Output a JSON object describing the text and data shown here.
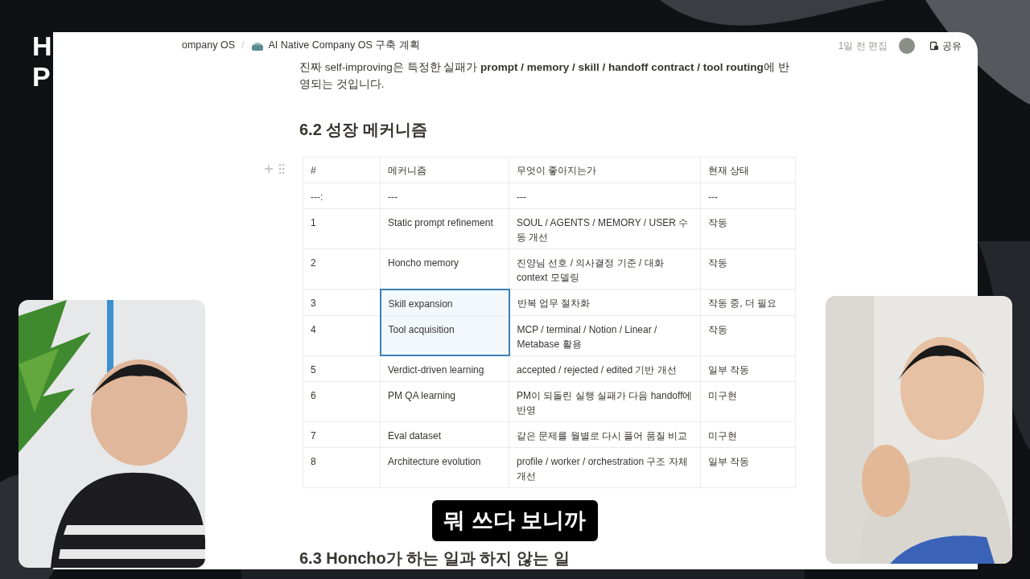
{
  "logo_letters": [
    "H",
    "P"
  ],
  "breadcrumb": {
    "parent": "ompany OS",
    "separator": "/",
    "page": "AI Native Company OS 구축 계획"
  },
  "edited": "1일 전 편집",
  "share_button": "공유",
  "intro_lines": [
    "진짜 self-improving은 특정한 실패가 **prompt / memory / skill / handoff contract / tool routing**에 반",
    "영되는 것입니다."
  ],
  "heading": "6.2 성장 메커니즘",
  "table": {
    "columns": [
      "#",
      "메커니즘",
      "무엇이 좋아지는가",
      "현재 상태"
    ],
    "rows": [
      {
        "cells": [
          "---:",
          "---",
          "---",
          "---"
        ],
        "selected": false
      },
      {
        "cells": [
          "1",
          "Static prompt refinement",
          "SOUL / AGENTS / MEMORY / USER 수동 개선",
          "작동"
        ],
        "selected": false
      },
      {
        "cells": [
          "2",
          "Honcho memory",
          "진양님 선호 / 의사결정 기준 / 대화 context 모델링",
          "작동"
        ],
        "selected": false
      },
      {
        "cells": [
          "3",
          "Skill expansion",
          "반복 업무 절차화",
          "작동 중, 더 필요"
        ],
        "selected": true
      },
      {
        "cells": [
          "4",
          "Tool acquisition",
          "MCP / terminal / Notion / Linear / Metabase 활용",
          "작동"
        ],
        "selected": true
      },
      {
        "cells": [
          "5",
          "Verdict-driven learning",
          "accepted / rejected / edited 기반 개선",
          "일부 작동"
        ],
        "selected": false
      },
      {
        "cells": [
          "6",
          "PM QA learning",
          "PM이 되돌린 실행 실패가 다음 handoff에 반영",
          "미구현"
        ],
        "selected": false
      },
      {
        "cells": [
          "7",
          "Eval dataset",
          "같은 문제를 월별로 다시 풀어 품질 비교",
          "미구현"
        ],
        "selected": false
      },
      {
        "cells": [
          "8",
          "Architecture evolution",
          "profile / worker / orchestration 구조 자체 개선",
          "일부 작동"
        ],
        "selected": false
      }
    ]
  },
  "next_heading": "6.3 Honcho가 하는 일과 하지 않는 일",
  "subtitle": "뭐 쓰다 보니까"
}
